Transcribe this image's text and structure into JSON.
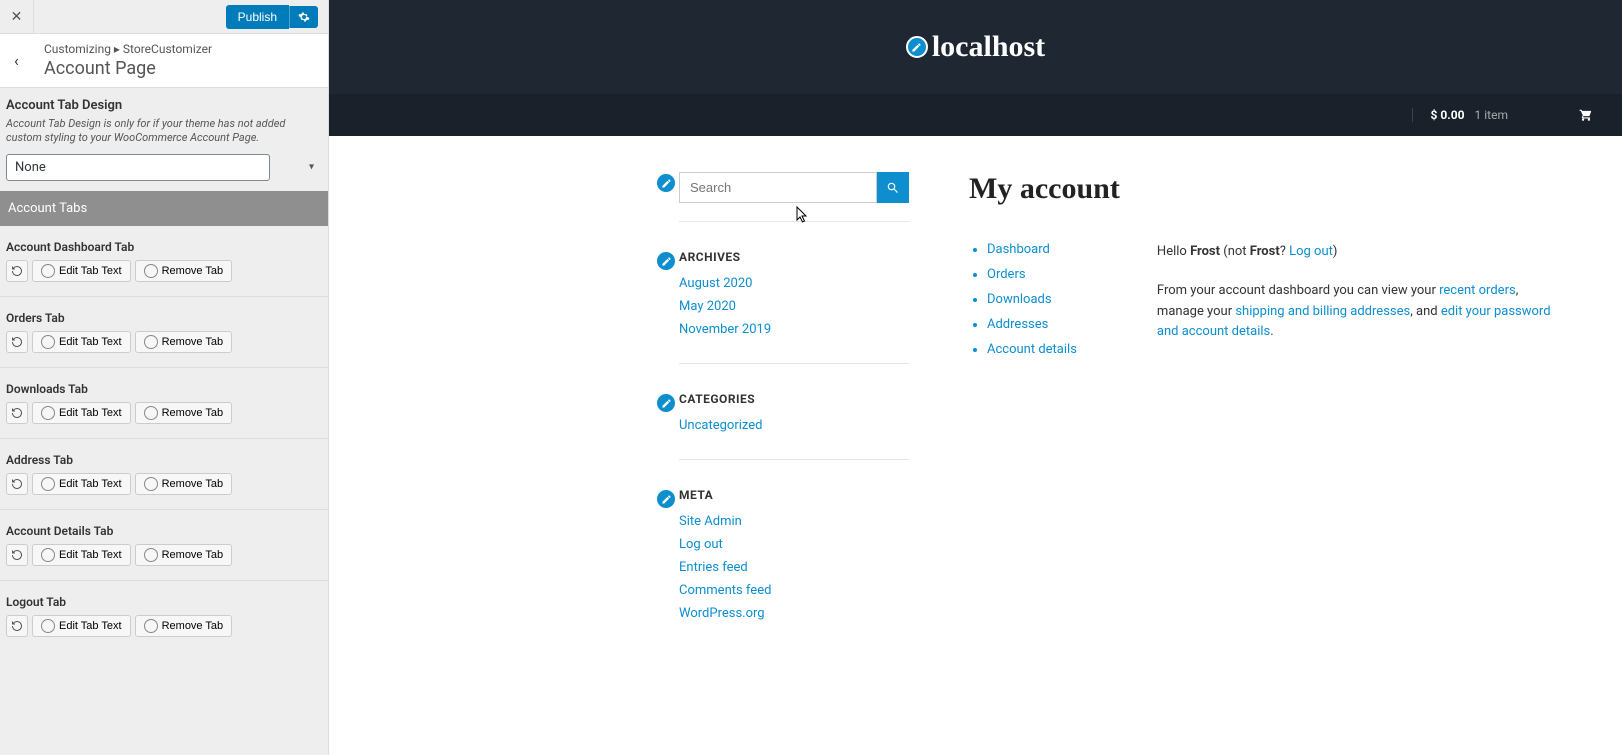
{
  "sidebar": {
    "publish_label": "Publish",
    "breadcrumb_prefix": "Customizing ▸ StoreCustomizer",
    "breadcrumb_title": "Account Page",
    "design_section": {
      "title": "Account Tab Design",
      "desc": "Account Tab Design is only for if your theme has not added custom styling to your WooCommerce Account Page.",
      "selected": "None"
    },
    "tabs_header": "Account Tabs",
    "edit_label": "Edit Tab Text",
    "remove_label": "Remove Tab",
    "tabs": [
      {
        "title": "Account Dashboard Tab"
      },
      {
        "title": "Orders Tab"
      },
      {
        "title": "Downloads Tab"
      },
      {
        "title": "Address Tab"
      },
      {
        "title": "Account Details Tab"
      },
      {
        "title": "Logout Tab"
      }
    ]
  },
  "preview": {
    "site_title": "localhost",
    "cart_price": "$ 0.00",
    "cart_items": "1 item",
    "search_placeholder": "Search",
    "widgets": {
      "archives": {
        "title": "ARCHIVES",
        "items": [
          "August 2020",
          "May 2020",
          "November 2019"
        ]
      },
      "categories": {
        "title": "CATEGORIES",
        "items": [
          "Uncategorized"
        ]
      },
      "meta": {
        "title": "META",
        "items": [
          "Site Admin",
          "Log out",
          "Entries feed",
          "Comments feed",
          "WordPress.org"
        ]
      }
    },
    "page_title": "My account",
    "account_nav": [
      "Dashboard",
      "Orders",
      "Downloads",
      "Addresses",
      "Account details"
    ],
    "greeting_hello": "Hello ",
    "greeting_user": "Frost",
    "greeting_not": " (not ",
    "greeting_user2": "Frost",
    "greeting_q": "? ",
    "greeting_logout": "Log out",
    "greeting_end": ")",
    "dash_text1": "From your account dashboard you can view your ",
    "dash_link1": "recent orders",
    "dash_text2": ", manage your ",
    "dash_link2": "shipping and billing addresses",
    "dash_text3": ", and ",
    "dash_link3": "edit your password and account details",
    "dash_text4": "."
  }
}
